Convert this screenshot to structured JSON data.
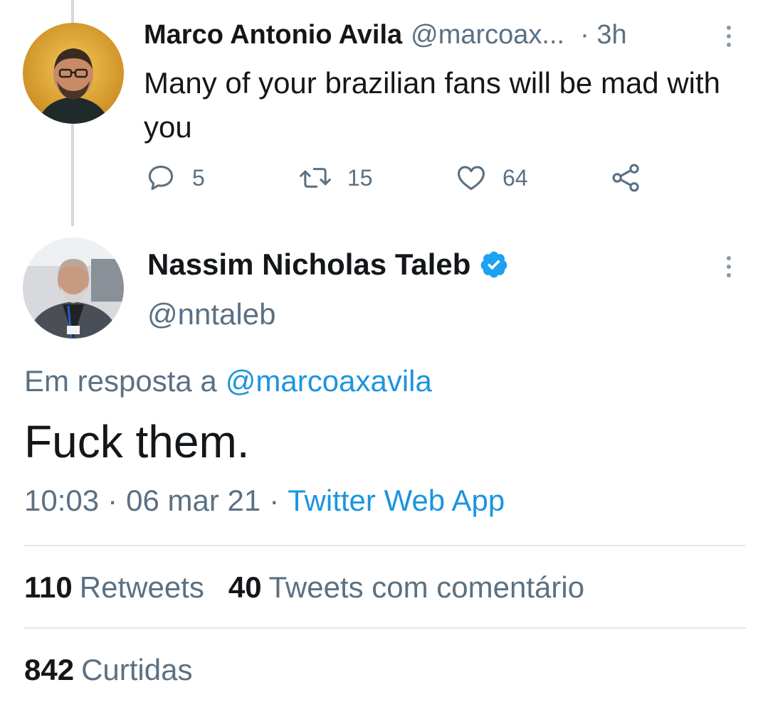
{
  "parent_tweet": {
    "author_name": "Marco Antonio Avila",
    "author_handle": "@marcoax...",
    "time": "· 3h",
    "text": "Many of your brazilian fans will be mad with you",
    "reply_count": "5",
    "retweet_count": "15",
    "like_count": "64",
    "icons": [
      "reply-icon",
      "retweet-icon",
      "like-icon",
      "share-icon",
      "more-icon"
    ]
  },
  "main_tweet": {
    "author_name": "Nassim Nicholas Taleb",
    "author_handle": "@nntaleb",
    "verified": true,
    "reply_prefix": "Em resposta a",
    "reply_mention": "@marcoaxavila",
    "text": "Fuck them.",
    "time": "10:03",
    "date": "06 mar 21",
    "source": "Twitter Web App",
    "separator": "·"
  },
  "stats": {
    "retweets_count": "110",
    "retweets_label": "Retweets",
    "quotes_count": "40",
    "quotes_label": "Tweets com comentário",
    "likes_count": "842",
    "likes_label": "Curtidas"
  },
  "colors": {
    "text": "#14171a",
    "secondary": "#5b7083",
    "link": "#1b95e0",
    "verified": "#1da1f2",
    "divider": "#e1e8ed"
  }
}
